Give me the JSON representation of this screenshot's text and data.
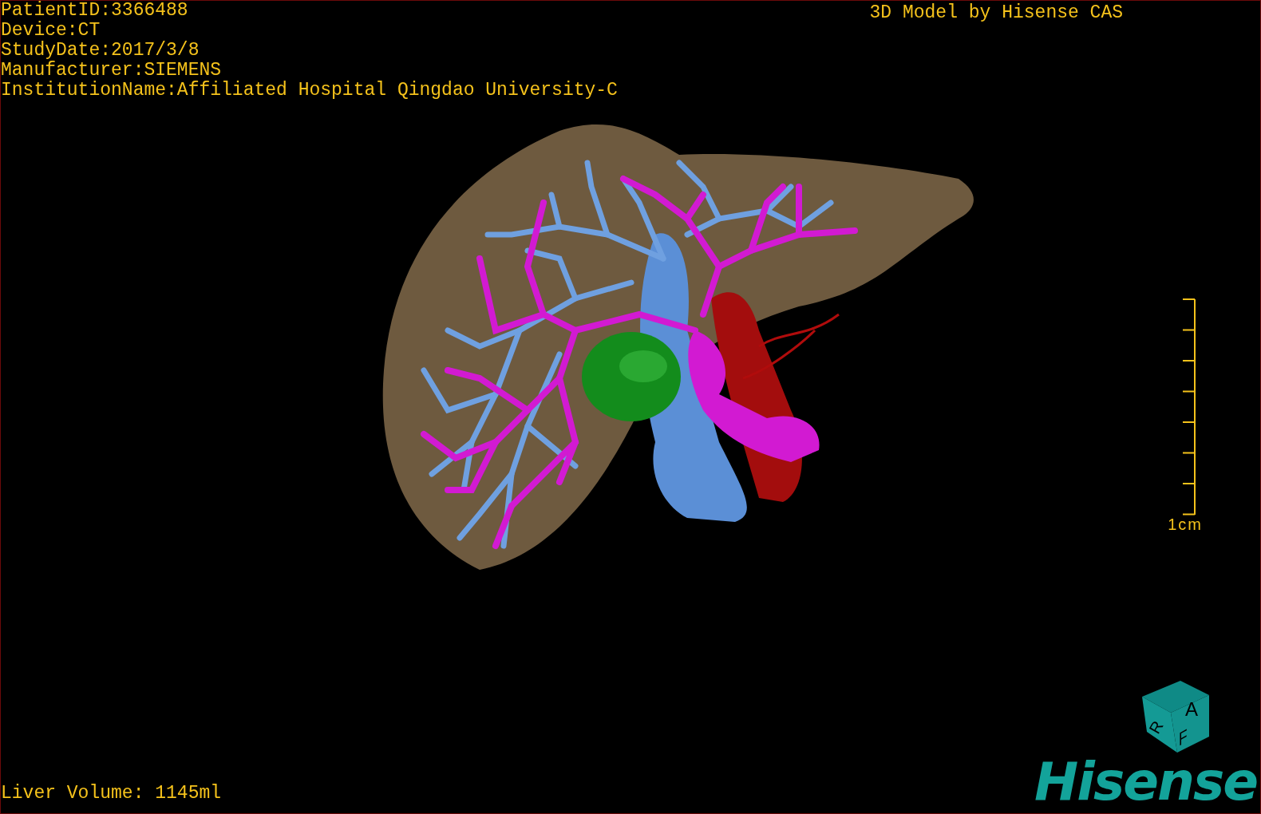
{
  "info_lines": [
    "PatientID:3366488",
    "Device:CT",
    "StudyDate:2017/3/8",
    "Manufacturer:SIEMENS",
    "InstitutionName:Affiliated Hospital Qingdao University-C"
  ],
  "title": "3D Model by Hisense CAS",
  "scale_bar": {
    "label": "1cm"
  },
  "liver_volume": "Liver Volume: 1145ml",
  "orientation_cube": {
    "labels": [
      "A",
      "R",
      "F"
    ]
  },
  "logo": "Hisense"
}
